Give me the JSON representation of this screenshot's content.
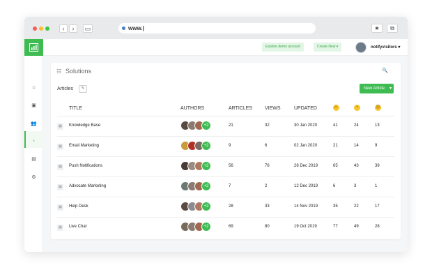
{
  "browser": {
    "url": "www.|",
    "back_icon": "chevron-left-icon",
    "forward_icon": "chevron-right-icon",
    "sidebar_toggle_icon": "sidebar-icon",
    "bookmark_icon": "star-icon",
    "window_icon": "window-icon"
  },
  "header": {
    "explore_label": "Explore demo account",
    "create_label": "Create New ▾",
    "username": "notifyvisitors",
    "brand_color": "#3ebc51"
  },
  "sidebar": {
    "items": [
      "home-icon",
      "contacts-icon",
      "users-icon",
      "lightbulb-icon",
      "document-icon",
      "gear-icon"
    ],
    "bottom": "apps-grid-icon"
  },
  "main": {
    "title": "Solutions",
    "section_label": "Articles",
    "new_article_label": "New Article",
    "columns": {
      "title": "TITLE",
      "authors": "AUTHORS",
      "articles": "ARTICLES",
      "views": "VIEWS",
      "updated": "UPDATED"
    },
    "rows": [
      {
        "title": "Knowledge Base",
        "authors_more": "+2",
        "articles": "21",
        "views": "32",
        "updated": "30 Jan 2020",
        "happy": "41",
        "neutral": "24",
        "sad": "13"
      },
      {
        "title": "Email Marketing",
        "authors_more": "+2",
        "articles": "9",
        "views": "6",
        "updated": "02 Jan 2020",
        "happy": "21",
        "neutral": "14",
        "sad": "9"
      },
      {
        "title": "Push Notifications",
        "authors_more": "+2",
        "articles": "56",
        "views": "76",
        "updated": "28 Dec 2019",
        "happy": "65",
        "neutral": "43",
        "sad": "39"
      },
      {
        "title": "Advocate Marketing",
        "authors_more": "+2",
        "articles": "7",
        "views": "2",
        "updated": "12 Dec 2019",
        "happy": "6",
        "neutral": "3",
        "sad": "1"
      },
      {
        "title": "Help Desk",
        "authors_more": "+2",
        "articles": "28",
        "views": "33",
        "updated": "14 Nov 2019",
        "happy": "35",
        "neutral": "22",
        "sad": "17"
      },
      {
        "title": "Live Chat",
        "authors_more": "+2",
        "articles": "69",
        "views": "80",
        "updated": "19 Oct 2019",
        "happy": "77",
        "neutral": "49",
        "sad": "28"
      }
    ]
  }
}
